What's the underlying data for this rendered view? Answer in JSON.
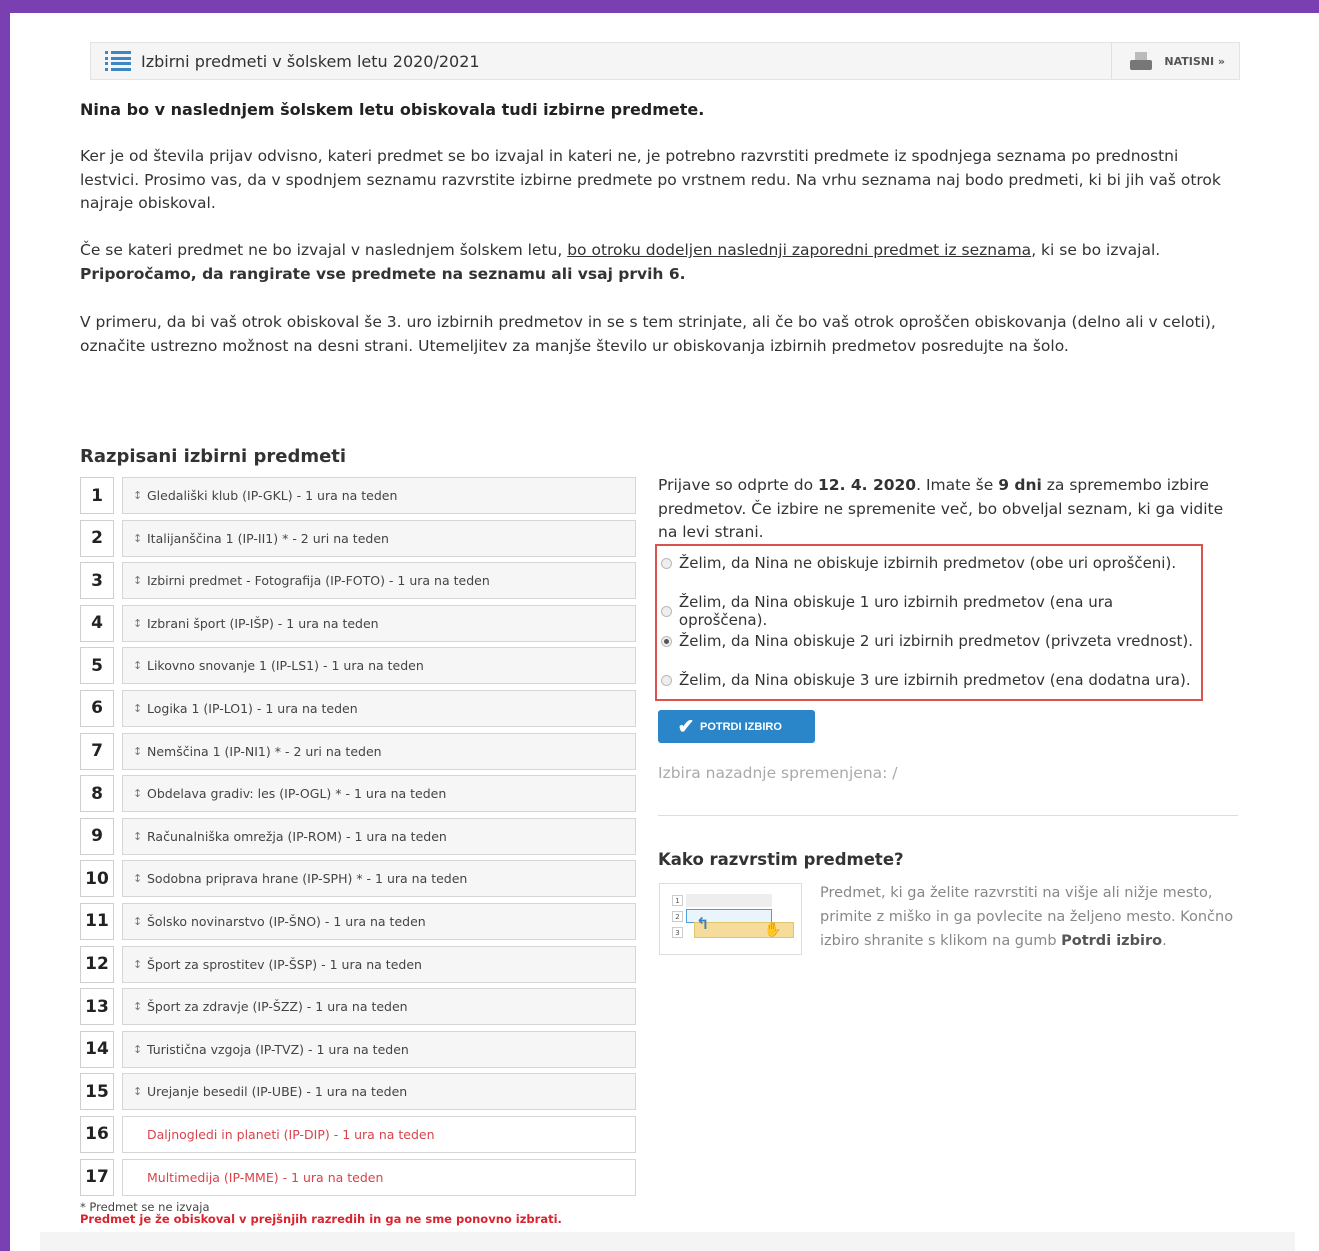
{
  "header": {
    "title": "Izbirni predmeti v šolskem letu 2020/2021",
    "print_label": "NATISNI »"
  },
  "intro": {
    "title": "Nina bo v naslednjem šolskem letu obiskovala tudi izbirne predmete.",
    "p1": "Ker je od števila prijav odvisno, kateri predmet se bo izvajal in kateri ne, je potrebno razvrstiti predmete iz spodnjega seznama po prednostni lestvici. Prosimo vas, da v spodnjem seznamu razvrstite izbirne predmete po vrstnem redu. Na vrhu seznama naj bodo predmeti, ki bi jih vaš otrok najraje obiskoval.",
    "p2_start": "Če se kateri predmet ne bo izvajal v naslednjem šolskem letu, ",
    "p2_link": "bo otroku dodeljen naslednji zaporedni predmet iz seznama",
    "p2_end": ", ki se bo izvajal.",
    "p2_bold": "Priporočamo, da rangirate vse predmete na seznamu ali vsaj prvih 6.",
    "p3": "V primeru, da bi vaš otrok obiskoval še 3. uro izbirnih predmetov in se s tem strinjate, ali če bo vaš otrok oproščen obiskovanja (delno ali v celoti), označite ustrezno možnost na desni strani. Utemeljitev za manjše število ur obiskovanja izbirnih predmetov posredujte na šolo."
  },
  "subjects": {
    "title": "Razpisani izbirni predmeti",
    "items": [
      {
        "num": "1",
        "label": "Gledališki klub (IP-GKL) - 1 ura na teden"
      },
      {
        "num": "2",
        "label": "Italijanščina 1 (IP-II1) * - 2 uri na teden"
      },
      {
        "num": "3",
        "label": "Izbirni predmet - Fotografija (IP-FOTO) - 1 ura na teden"
      },
      {
        "num": "4",
        "label": "Izbrani šport (IP-IŠP) - 1 ura na teden"
      },
      {
        "num": "5",
        "label": "Likovno snovanje 1 (IP-LS1) - 1 ura na teden"
      },
      {
        "num": "6",
        "label": "Logika 1 (IP-LO1) - 1 ura na teden"
      },
      {
        "num": "7",
        "label": "Nemščina 1 (IP-NI1) * - 2 uri na teden"
      },
      {
        "num": "8",
        "label": "Obdelava gradiv: les (IP-OGL) * - 1 ura na teden"
      },
      {
        "num": "9",
        "label": "Računalniška omrežja (IP-ROM) - 1 ura na teden"
      },
      {
        "num": "10",
        "label": "Sodobna priprava hrane (IP-SPH) * - 1 ura na teden"
      },
      {
        "num": "11",
        "label": "Šolsko novinarstvo (IP-ŠNO) - 1 ura na teden"
      },
      {
        "num": "12",
        "label": "Šport za sprostitev (IP-ŠSP) - 1 ura na teden"
      },
      {
        "num": "13",
        "label": "Šport za zdravje (IP-ŠZZ) - 1 ura na teden"
      },
      {
        "num": "14",
        "label": "Turistična vzgoja (IP-TVZ) - 1 ura na teden"
      },
      {
        "num": "15",
        "label": "Urejanje besedil (IP-UBE) - 1 ura na teden"
      },
      {
        "num": "16",
        "label": "Daljnogledi in planeti (IP-DIP) - 1 ura na teden"
      },
      {
        "num": "17",
        "label": "Multimedija (IP-MME) - 1 ura na teden"
      }
    ],
    "footnote_star": "* Predmet se ne izvaja",
    "footnote_red": "Predmet je že obiskoval v prejšnjih razredih in ga ne sme ponovno izbrati."
  },
  "deadline": {
    "t1": "Prijave so odprte do ",
    "date": "12. 4. 2020",
    "t2": ". Imate še ",
    "days": "9 dni",
    "t3": " za spremembo izbire predmetov. Če izbire ne spremenite več, bo obveljal seznam, ki ga vidite na levi strani."
  },
  "options": [
    {
      "label": "Želim, da Nina ne obiskuje izbirnih predmetov (obe uri oproščeni).",
      "checked": false
    },
    {
      "label": "Želim, da Nina obiskuje 1 uro izbirnih predmetov (ena ura oproščena).",
      "checked": false
    },
    {
      "label": "Želim, da Nina obiskuje 2 uri izbirnih predmetov (privzeta vrednost).",
      "checked": true
    },
    {
      "label": "Želim, da Nina obiskuje 3 ure izbirnih predmetov (ena dodatna ura).",
      "checked": false
    }
  ],
  "confirm_label": "POTRDI IZBIRO",
  "last_changed": "Izbira nazadnje spremenjena: /",
  "howto": {
    "title": "Kako razvrstim predmete?",
    "text": "Predmet, ki ga želite razvrstiti na višje ali nižje mesto, primite z miško in ga povlecite na željeno mesto. Končno izbiro shranite s klikom na gumb ",
    "bold": "Potrdi izbiro",
    "end": "."
  }
}
